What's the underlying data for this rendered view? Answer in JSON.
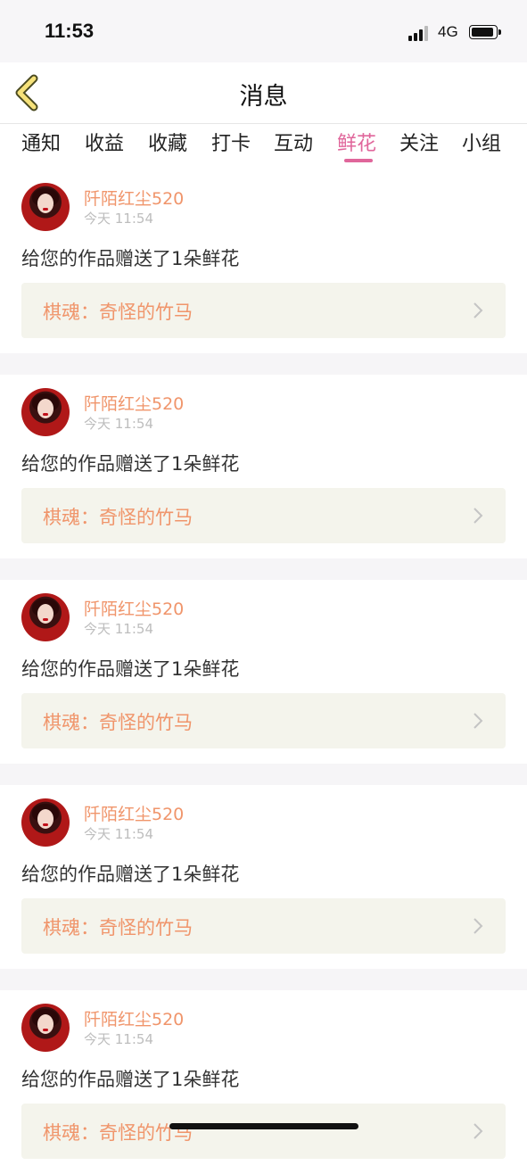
{
  "status_bar": {
    "time": "11:53",
    "network": "4G"
  },
  "nav": {
    "title": "消息",
    "back_icon": "chevron-left-icon"
  },
  "tabs": [
    {
      "label": "通知"
    },
    {
      "label": "收益"
    },
    {
      "label": "收藏"
    },
    {
      "label": "打卡"
    },
    {
      "label": "互动"
    },
    {
      "label": "鲜花",
      "active": true
    },
    {
      "label": "关注"
    },
    {
      "label": "小组"
    }
  ],
  "colors": {
    "accent": "#e0669b",
    "username": "#f0956b",
    "link_bg": "#f4f4ec"
  },
  "messages": [
    {
      "username": "阡陌红尘520",
      "time": "今天 11:54",
      "text": "给您的作品赠送了1朵鲜花",
      "work": "棋魂：奇怪的竹马"
    },
    {
      "username": "阡陌红尘520",
      "time": "今天 11:54",
      "text": "给您的作品赠送了1朵鲜花",
      "work": "棋魂：奇怪的竹马"
    },
    {
      "username": "阡陌红尘520",
      "time": "今天 11:54",
      "text": "给您的作品赠送了1朵鲜花",
      "work": "棋魂：奇怪的竹马"
    },
    {
      "username": "阡陌红尘520",
      "time": "今天 11:54",
      "text": "给您的作品赠送了1朵鲜花",
      "work": "棋魂：奇怪的竹马"
    },
    {
      "username": "阡陌红尘520",
      "time": "今天 11:54",
      "text": "给您的作品赠送了1朵鲜花",
      "work": "棋魂：奇怪的竹马"
    }
  ]
}
